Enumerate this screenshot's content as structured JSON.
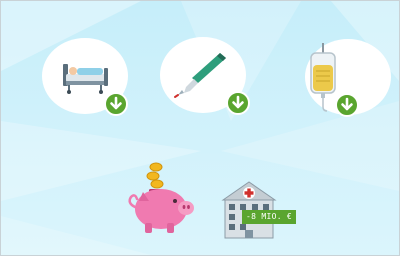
{
  "scene": {
    "colors": {
      "sky_top": "#c8f0fa",
      "sky_bottom": "#d7f4fb",
      "accent_green": "#5aa52f",
      "piggy_pink": "#f07ab0",
      "coin_gold": "#f2b71f"
    },
    "cost_items": [
      {
        "icon": "hospital-bed-icon"
      },
      {
        "icon": "scalpel-icon"
      },
      {
        "icon": "iv-drip-bag-icon"
      }
    ],
    "savings": {
      "icon": "piggy-bank-icon",
      "coins_icon": "coins-icon"
    },
    "hospital": {
      "icon": "hospital-building-icon",
      "badge_text": "-8 MIO. €"
    }
  }
}
